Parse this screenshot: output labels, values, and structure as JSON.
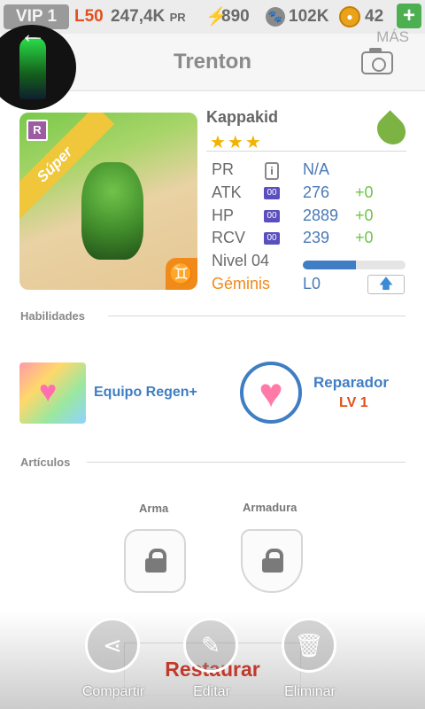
{
  "status_bar": {
    "vip": "VIP 1",
    "level": "L50",
    "pr_value": "247,4K",
    "pr_unit": "PR",
    "energy": "890",
    "paws": "102K",
    "coins": "42",
    "add": "+"
  },
  "header": {
    "title": "Trenton",
    "more": "MÁS",
    "back": "←"
  },
  "card": {
    "rarity_badge": "R",
    "ribbon": "Súper",
    "zodiac_symbol": "♊"
  },
  "monster": {
    "name": "Kappakid",
    "stars": "★★★",
    "stats": [
      {
        "label": "PR",
        "icon": "i",
        "value": "N/A",
        "bonus": ""
      },
      {
        "label": "ATK",
        "icon": "00",
        "value": "276",
        "bonus": "+0"
      },
      {
        "label": "HP",
        "icon": "00",
        "value": "2889",
        "bonus": "+0"
      },
      {
        "label": "RCV",
        "icon": "00",
        "value": "239",
        "bonus": "+0"
      }
    ],
    "level_label": "Nivel 04",
    "level_progress": 0.52,
    "sign": "Géminis",
    "sign_level": "L0",
    "upgrade": "🡅"
  },
  "abilities": {
    "section": "Habilidades",
    "skill_name": "Equipo Regen+",
    "skill2_name": "Reparador",
    "skill2_level": "LV 1"
  },
  "items": {
    "section": "Artículos",
    "weapon": "Arma",
    "armor": "Armadura"
  },
  "actions": {
    "restore": "Restaurar",
    "share": "Compartir",
    "edit": "Editar",
    "delete": "Eliminar"
  },
  "colors": {
    "accent_blue": "#3f7ec4",
    "orange": "#f08a1a",
    "green": "#6fc44a",
    "red": "#e2501e"
  }
}
